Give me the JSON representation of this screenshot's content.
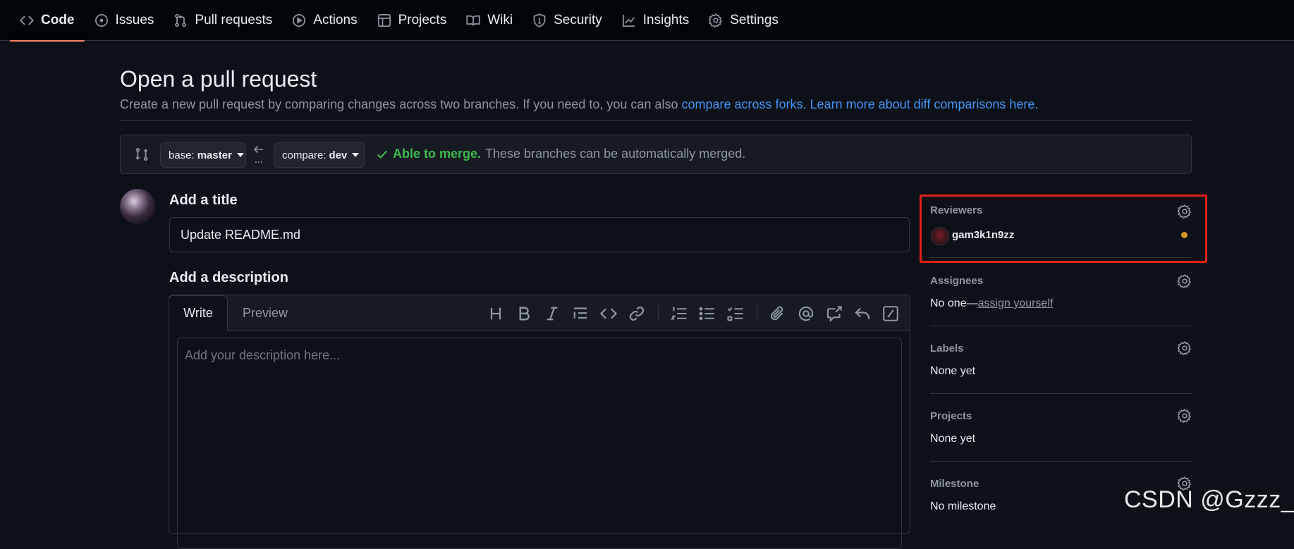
{
  "nav": {
    "tabs": [
      {
        "label": "Code",
        "icon": "code-icon",
        "active": true
      },
      {
        "label": "Issues",
        "icon": "issue-icon"
      },
      {
        "label": "Pull requests",
        "icon": "pull-request-icon"
      },
      {
        "label": "Actions",
        "icon": "play-icon"
      },
      {
        "label": "Projects",
        "icon": "table-icon"
      },
      {
        "label": "Wiki",
        "icon": "book-icon"
      },
      {
        "label": "Security",
        "icon": "shield-icon"
      },
      {
        "label": "Insights",
        "icon": "graph-icon"
      },
      {
        "label": "Settings",
        "icon": "gear-icon"
      }
    ]
  },
  "header": {
    "title": "Open a pull request",
    "subtitle": "Create a new pull request by comparing changes across two branches. If you need to, you can also ",
    "link_forks": "compare across forks.",
    "link_learn": "Learn more about diff comparisons here."
  },
  "compare": {
    "base_prefix": "base:",
    "base_branch": "master",
    "compare_prefix": "compare:",
    "compare_branch": "dev",
    "merge_ok": "Able to merge.",
    "merge_msg": "These branches can be automatically merged."
  },
  "form": {
    "title_label": "Add a title",
    "title_value": "Update README.md",
    "desc_label": "Add a description",
    "tab_write": "Write",
    "tab_preview": "Preview",
    "desc_placeholder": "Add your description here..."
  },
  "sidebar": {
    "reviewers": {
      "title": "Reviewers",
      "user": "gam3k1n9zz",
      "status_color": "#d29922"
    },
    "assignees": {
      "title": "Assignees",
      "value": "No one—",
      "link": "assign yourself"
    },
    "labels": {
      "title": "Labels",
      "value": "None yet"
    },
    "projects": {
      "title": "Projects",
      "value": "None yet"
    },
    "milestone": {
      "title": "Milestone",
      "value": "No milestone"
    }
  },
  "watermark": "CSDN @Gzzz__",
  "colors": {
    "accent_tab": "#f78166",
    "link": "#4493f8",
    "success": "#3fb950",
    "highlight": "#e0201a"
  }
}
